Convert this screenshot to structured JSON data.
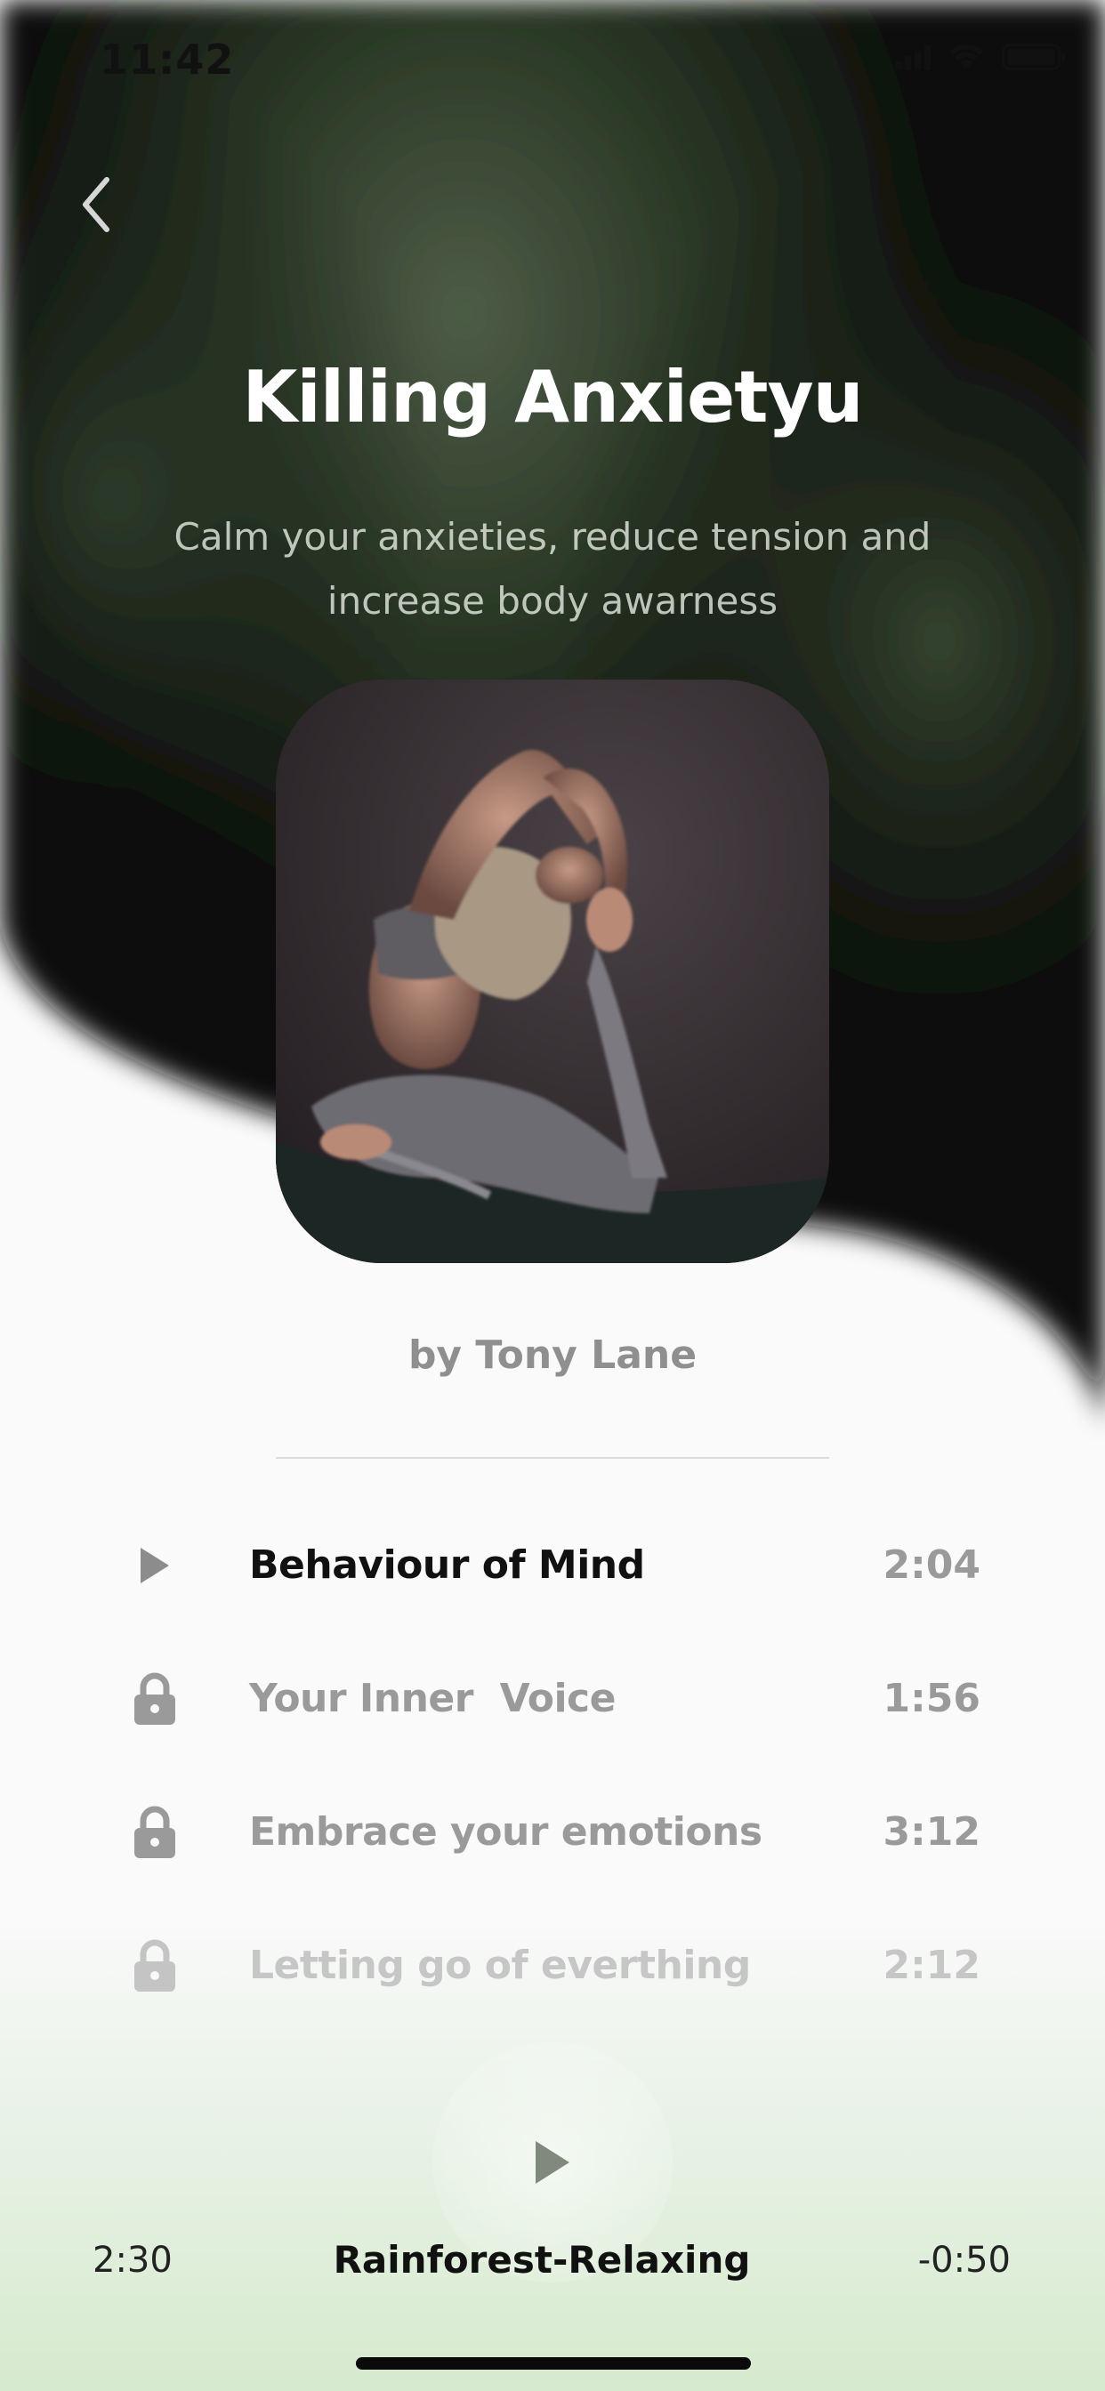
{
  "status_bar": {
    "time": "11:42"
  },
  "header": {
    "title": "Killing Anxietyu",
    "subtitle": "Calm your anxieties, reduce tension and increase body awarness"
  },
  "author": "by Tony Lane",
  "tracks": [
    {
      "title": "Behaviour of Mind",
      "duration": "2:04",
      "icon": "play-icon",
      "state": "active"
    },
    {
      "title": "Your Inner  Voice",
      "duration": "1:56",
      "icon": "lock-icon",
      "state": "locked"
    },
    {
      "title": "Embrace your emotions",
      "duration": "3:12",
      "icon": "lock-icon",
      "state": "locked"
    },
    {
      "title": "Letting go of everthing",
      "duration": "2:12",
      "icon": "lock-icon",
      "state": "locked"
    }
  ],
  "player": {
    "elapsed": "2:30",
    "track_name": "Rainforest-Relaxing",
    "remaining": "-0:50"
  },
  "colors": {
    "hero_dark": "#0b0d0a",
    "hero_green": "#4a5a44",
    "background": "#fafafa",
    "bottom_green": "#d6eace",
    "text_primary": "#111111",
    "text_muted": "#9a9a9a"
  }
}
